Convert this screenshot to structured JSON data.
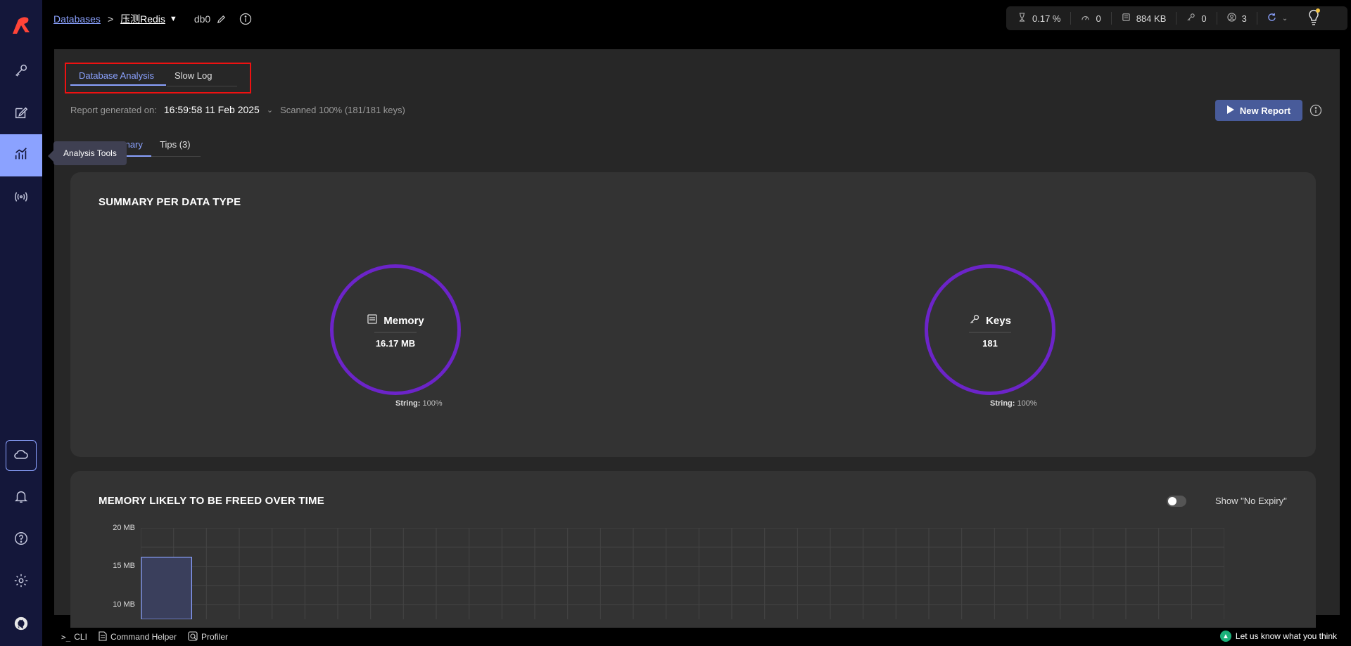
{
  "sidebar": {
    "tooltip": "Analysis Tools",
    "items": [
      {
        "icon": "key-icon",
        "active": false
      },
      {
        "icon": "edit-icon",
        "active": false
      },
      {
        "icon": "analysis-icon",
        "active": true
      },
      {
        "icon": "pubsub-icon",
        "active": false
      }
    ],
    "bottom": [
      "cloud-icon",
      "bell-icon",
      "help-icon",
      "gear-icon",
      "github-icon"
    ]
  },
  "breadcrumb": {
    "databases": "Databases",
    "separator": ">",
    "db_name": "压测Redis",
    "db_index": "db0"
  },
  "stats": {
    "cpu": "0.17 %",
    "ops": "0",
    "memory": "884 KB",
    "keys": "0",
    "clients": "3"
  },
  "tabs": {
    "database_analysis": "Database Analysis",
    "slow_log": "Slow Log"
  },
  "report": {
    "label": "Report generated on:",
    "date": "16:59:58 11 Feb 2025",
    "scanned": "Scanned 100% (181/181 keys)",
    "new_report": "New Report"
  },
  "subtabs": {
    "summary": "Summary",
    "summary_visible": "mary",
    "tips": "Tips (3)"
  },
  "summary": {
    "title": "SUMMARY PER DATA TYPE",
    "memory": {
      "label": "Memory",
      "value": "16.17 MB",
      "note_type": "String:",
      "note_pct": "100%"
    },
    "keys": {
      "label": "Keys",
      "value": "181",
      "note_type": "String:",
      "note_pct": "100%"
    }
  },
  "memory_chart": {
    "title": "MEMORY LIKELY TO BE FREED OVER TIME",
    "toggle_label": "Show \"No Expiry\""
  },
  "chart_data": {
    "type": "bar",
    "title": "MEMORY LIKELY TO BE FREED OVER TIME",
    "y_ticks": [
      "20 MB",
      "15 MB",
      "10 MB"
    ],
    "ylim": [
      0,
      20
    ],
    "unit": "MB",
    "values": [
      16.17
    ],
    "grid": true
  },
  "footer": {
    "cli": "CLI",
    "command_helper": "Command Helper",
    "profiler": "Profiler",
    "feedback": "Let us know what you think"
  },
  "colors": {
    "accent": "#8ba2ff",
    "sidebar": "#14173a",
    "circle": "#6c24c9",
    "highlight_box": "#ee1111",
    "new_report_button": "#485b9a"
  }
}
